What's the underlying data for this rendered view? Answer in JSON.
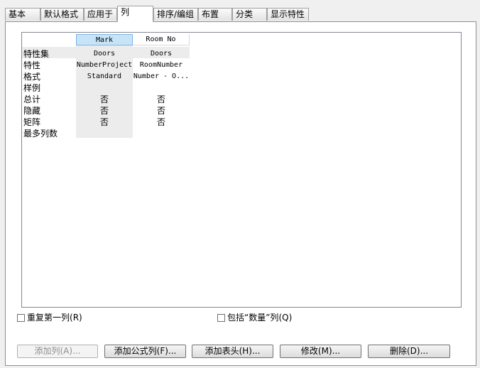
{
  "tabs": [
    {
      "label": "基本"
    },
    {
      "label": "默认格式"
    },
    {
      "label": "应用于"
    },
    {
      "label": "列"
    },
    {
      "label": "排序/编组"
    },
    {
      "label": "布置"
    },
    {
      "label": "分类"
    },
    {
      "label": "显示特性"
    }
  ],
  "active_tab": "列",
  "grid": {
    "columns": [
      "Mark",
      "Room No"
    ],
    "selected_column": "Mark",
    "row_labels": [
      "特性集",
      "特性",
      "格式",
      "样例",
      "总计",
      "隐藏",
      "矩阵",
      "最多列数"
    ],
    "rows": [
      [
        "Doors",
        "Doors"
      ],
      [
        "NumberProject",
        "RoomNumber"
      ],
      [
        "Standard",
        "Number - O..."
      ],
      [
        "",
        ""
      ],
      [
        "否",
        "否"
      ],
      [
        "否",
        "否"
      ],
      [
        "否",
        "否"
      ],
      [
        "",
        ""
      ]
    ]
  },
  "options": {
    "repeat_first_column": {
      "label": "重复第一列",
      "mnemonic": "(R)",
      "checked": false
    },
    "include_quantity": {
      "label": "包括“数量”列",
      "mnemonic": "(Q)",
      "checked": false
    }
  },
  "buttons": {
    "add_column": {
      "label": "添加列",
      "mnemonic": "(A)...",
      "enabled": false
    },
    "add_formula_column": {
      "label": "添加公式列",
      "mnemonic": "(F)..."
    },
    "add_header": {
      "label": "添加表头",
      "mnemonic": "(H)..."
    },
    "modify": {
      "label": "修改",
      "mnemonic": "(M)..."
    },
    "delete": {
      "label": "删除",
      "mnemonic": "(D)..."
    }
  }
}
